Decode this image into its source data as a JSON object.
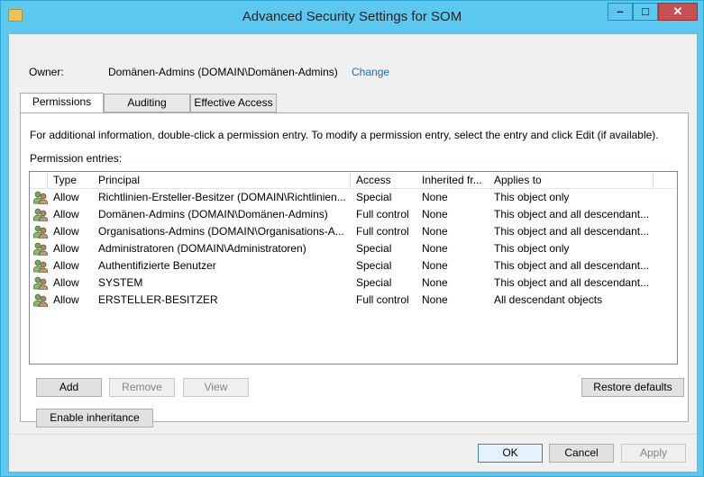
{
  "window": {
    "title": "Advanced Security Settings for SOM",
    "controls": {
      "minimize": "–",
      "maximize": "□",
      "close": "✕"
    }
  },
  "owner": {
    "label": "Owner:",
    "value": "Domänen-Admins (DOMAIN\\Domänen-Admins)",
    "change_link": "Change"
  },
  "tabs": [
    {
      "label": "Permissions",
      "active": true
    },
    {
      "label": "Auditing",
      "active": false
    },
    {
      "label": "Effective Access",
      "active": false
    }
  ],
  "permissions": {
    "info_text": "For additional information, double-click a permission entry. To modify a permission entry, select the entry and click Edit (if available).",
    "entries_label": "Permission entries:",
    "columns": [
      "Type",
      "Principal",
      "Access",
      "Inherited fr...",
      "Applies to"
    ],
    "rows": [
      {
        "type": "Allow",
        "principal": "Richtlinien-Ersteller-Besitzer (DOMAIN\\Richtlinien...",
        "access": "Special",
        "inherited": "None",
        "applies_to": "This object only"
      },
      {
        "type": "Allow",
        "principal": "Domänen-Admins (DOMAIN\\Domänen-Admins)",
        "access": "Full control",
        "inherited": "None",
        "applies_to": "This object and all descendant..."
      },
      {
        "type": "Allow",
        "principal": "Organisations-Admins (DOMAIN\\Organisations-A...",
        "access": "Full control",
        "inherited": "None",
        "applies_to": "This object and all descendant..."
      },
      {
        "type": "Allow",
        "principal": "Administratoren (DOMAIN\\Administratoren)",
        "access": "Special",
        "inherited": "None",
        "applies_to": "This object only"
      },
      {
        "type": "Allow",
        "principal": "Authentifizierte Benutzer",
        "access": "Special",
        "inherited": "None",
        "applies_to": "This object and all descendant..."
      },
      {
        "type": "Allow",
        "principal": "SYSTEM",
        "access": "Special",
        "inherited": "None",
        "applies_to": "This object and all descendant..."
      },
      {
        "type": "Allow",
        "principal": "ERSTELLER-BESITZER",
        "access": "Full control",
        "inherited": "None",
        "applies_to": "All descendant objects"
      }
    ],
    "buttons": {
      "add": "Add",
      "remove": "Remove",
      "view": "View",
      "restore_defaults": "Restore defaults",
      "enable_inheritance": "Enable inheritance"
    }
  },
  "footer": {
    "ok": "OK",
    "cancel": "Cancel",
    "apply": "Apply"
  },
  "colors": {
    "titlebar": "#5cc8ef",
    "close": "#c75050",
    "link": "#1a6fbf"
  }
}
